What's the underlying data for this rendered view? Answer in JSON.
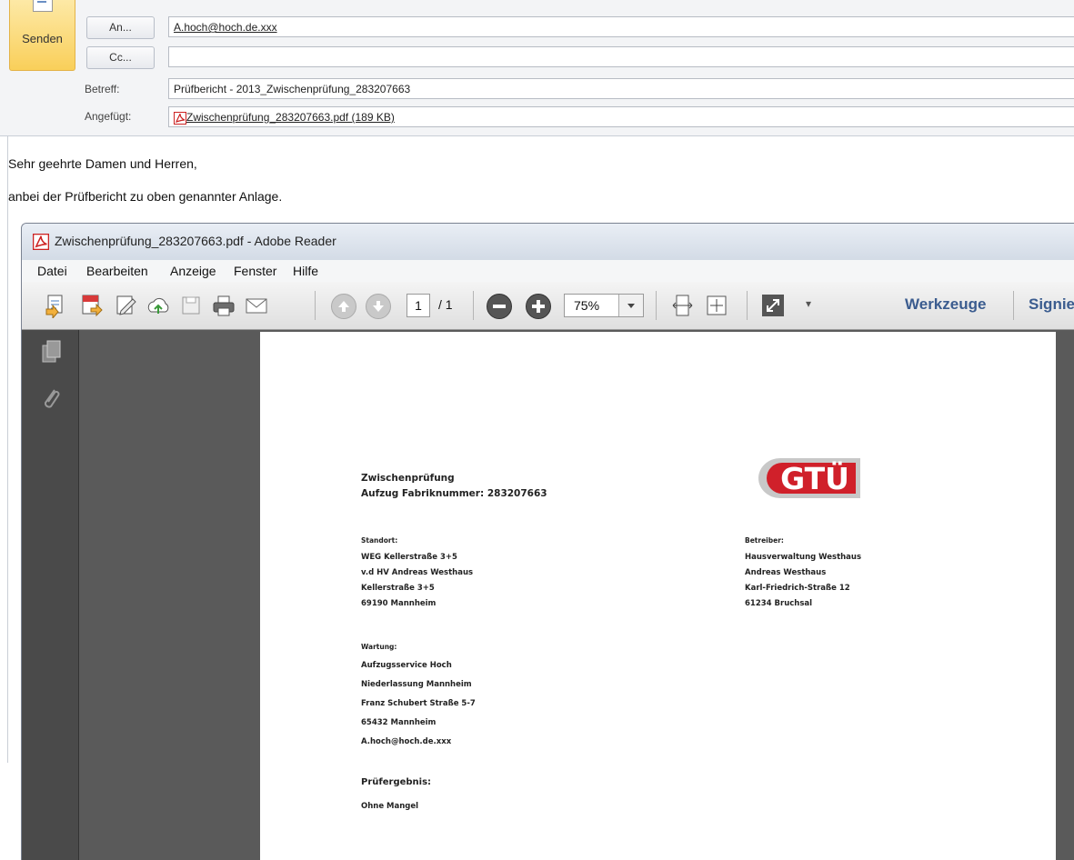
{
  "email": {
    "send_label": "Senden",
    "to_button": "An...",
    "cc_button": "Cc...",
    "to_value": "A.hoch@hoch.de.xxx",
    "cc_value": "",
    "subject_label": "Betreff:",
    "subject_value": "Prüfbericht -  2013_Zwischenprüfung_283207663",
    "attached_label": "Angefügt:",
    "attachment": "Zwischenprüfung_283207663.pdf (189 KB)",
    "body_line1": "Sehr geehrte Damen und Herren,",
    "body_line2": "anbei der Prüfbericht zu oben genannter Anlage."
  },
  "reader": {
    "window_title": "Zwischenprüfung_283207663.pdf - Adobe Reader",
    "menu": [
      "Datei",
      "Bearbeiten",
      "Anzeige",
      "Fenster",
      "Hilfe"
    ],
    "page_current": "1",
    "page_total": "/ 1",
    "zoom": "75%",
    "tools_label": "Werkzeuge",
    "sign_label": "Signie"
  },
  "document": {
    "logo_text": "GTÜ",
    "title_line1": "Zwischenprüfung",
    "title_line2": "Aufzug Fabriknummer: 283207663",
    "standort_heading": "Standort:",
    "standort_lines": [
      "WEG Kellerstraße 3+5",
      "v.d HV Andreas Westhaus",
      "Kellerstraße 3+5",
      "69190 Mannheim"
    ],
    "betreiber_heading": "Betreiber:",
    "betreiber_lines": [
      "Hausverwaltung Westhaus",
      "Andreas Westhaus",
      "Karl-Friedrich-Straße 12",
      "61234 Bruchsal"
    ],
    "wartung_heading": "Wartung:",
    "wartung_lines": [
      "Aufzugsservice Hoch",
      "Niederlassung Mannheim",
      "Franz Schubert Straße 5-7",
      "65432 Mannheim",
      "A.hoch@hoch.de.xxx"
    ],
    "result_heading": "Prüfergebnis:",
    "result_value": "Ohne Mangel"
  },
  "colors": {
    "tools_blue": "#3b5c8f",
    "logo_red": "#d0202a",
    "send_yellow": "#f9cf5a"
  }
}
